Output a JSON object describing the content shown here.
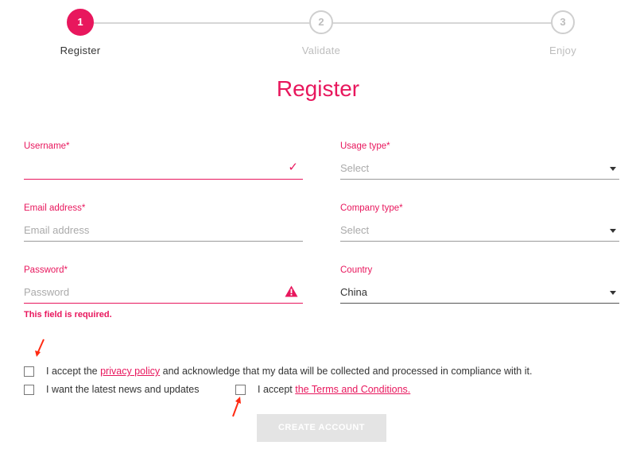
{
  "stepper": {
    "steps": [
      {
        "number": "1",
        "label": "Register"
      },
      {
        "number": "2",
        "label": "Validate"
      },
      {
        "number": "3",
        "label": "Enjoy"
      }
    ],
    "active_step": 1
  },
  "form": {
    "title": "Register",
    "username": {
      "label": "Username*",
      "value": "",
      "status_icon": "check-icon"
    },
    "email": {
      "label": "Email address*",
      "placeholder": "Email address"
    },
    "password": {
      "label": "Password*",
      "placeholder": "Password",
      "status_icon": "warning-icon",
      "error": "This field is required."
    },
    "usage_type": {
      "label": "Usage type*",
      "selected": "Select"
    },
    "company_type": {
      "label": "Company type*",
      "selected": "Select"
    },
    "country": {
      "label": "Country",
      "selected": "China"
    }
  },
  "consents": {
    "privacy": {
      "prefix": "I accept the ",
      "link": "privacy policy",
      "suffix": " and acknowledge that my data will be collected and processed in compliance with it.",
      "checked": false
    },
    "news": {
      "label": "I want the latest news and updates",
      "checked": false
    },
    "terms": {
      "prefix": "I accept ",
      "link": "the Terms and Conditions.",
      "checked": false
    }
  },
  "create_button": {
    "label": "CREATE ACCOUNT",
    "disabled": true
  },
  "colors": {
    "accent": "#e8175d",
    "arrow": "#ff2a12",
    "muted": "#bdbdbd",
    "button_disabled": "#e4e4e4"
  }
}
